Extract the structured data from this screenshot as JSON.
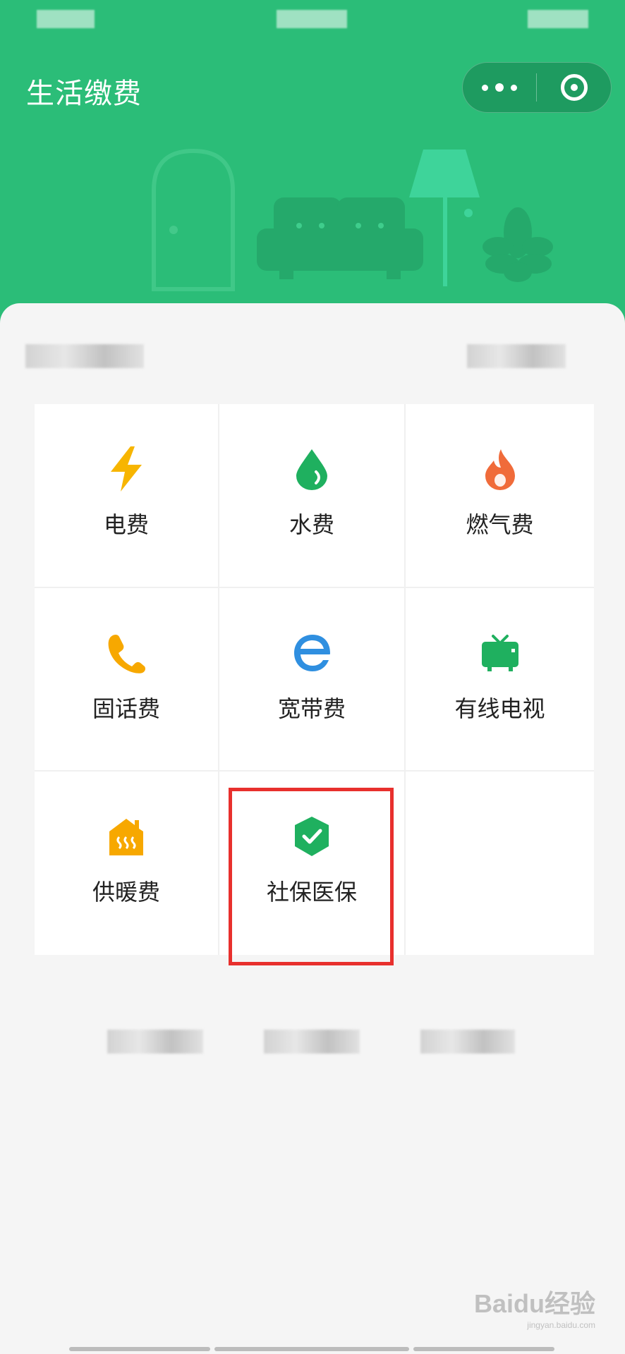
{
  "header": {
    "title": "生活缴费",
    "bg_color": "#2bbd78"
  },
  "capsule": {
    "more_icon": "more-dots-icon",
    "close_icon": "target-close-icon"
  },
  "services": [
    {
      "label": "电费",
      "icon": "lightning-icon",
      "color": "#f7b500"
    },
    {
      "label": "水费",
      "icon": "water-drop-icon",
      "color": "#1fb05f"
    },
    {
      "label": "燃气费",
      "icon": "flame-icon",
      "color": "#f06b3a"
    },
    {
      "label": "固话费",
      "icon": "phone-icon",
      "color": "#f7a800"
    },
    {
      "label": "宽带费",
      "icon": "browser-e-icon",
      "color": "#2f8fe0"
    },
    {
      "label": "有线电视",
      "icon": "tv-icon",
      "color": "#1fb05f"
    },
    {
      "label": "供暖费",
      "icon": "heating-house-icon",
      "color": "#f7a800"
    },
    {
      "label": "社保医保",
      "icon": "shield-check-icon",
      "color": "#1fb05f"
    }
  ],
  "watermark": {
    "brand": "Baidu经验",
    "url": "jingyan.baidu.com"
  }
}
